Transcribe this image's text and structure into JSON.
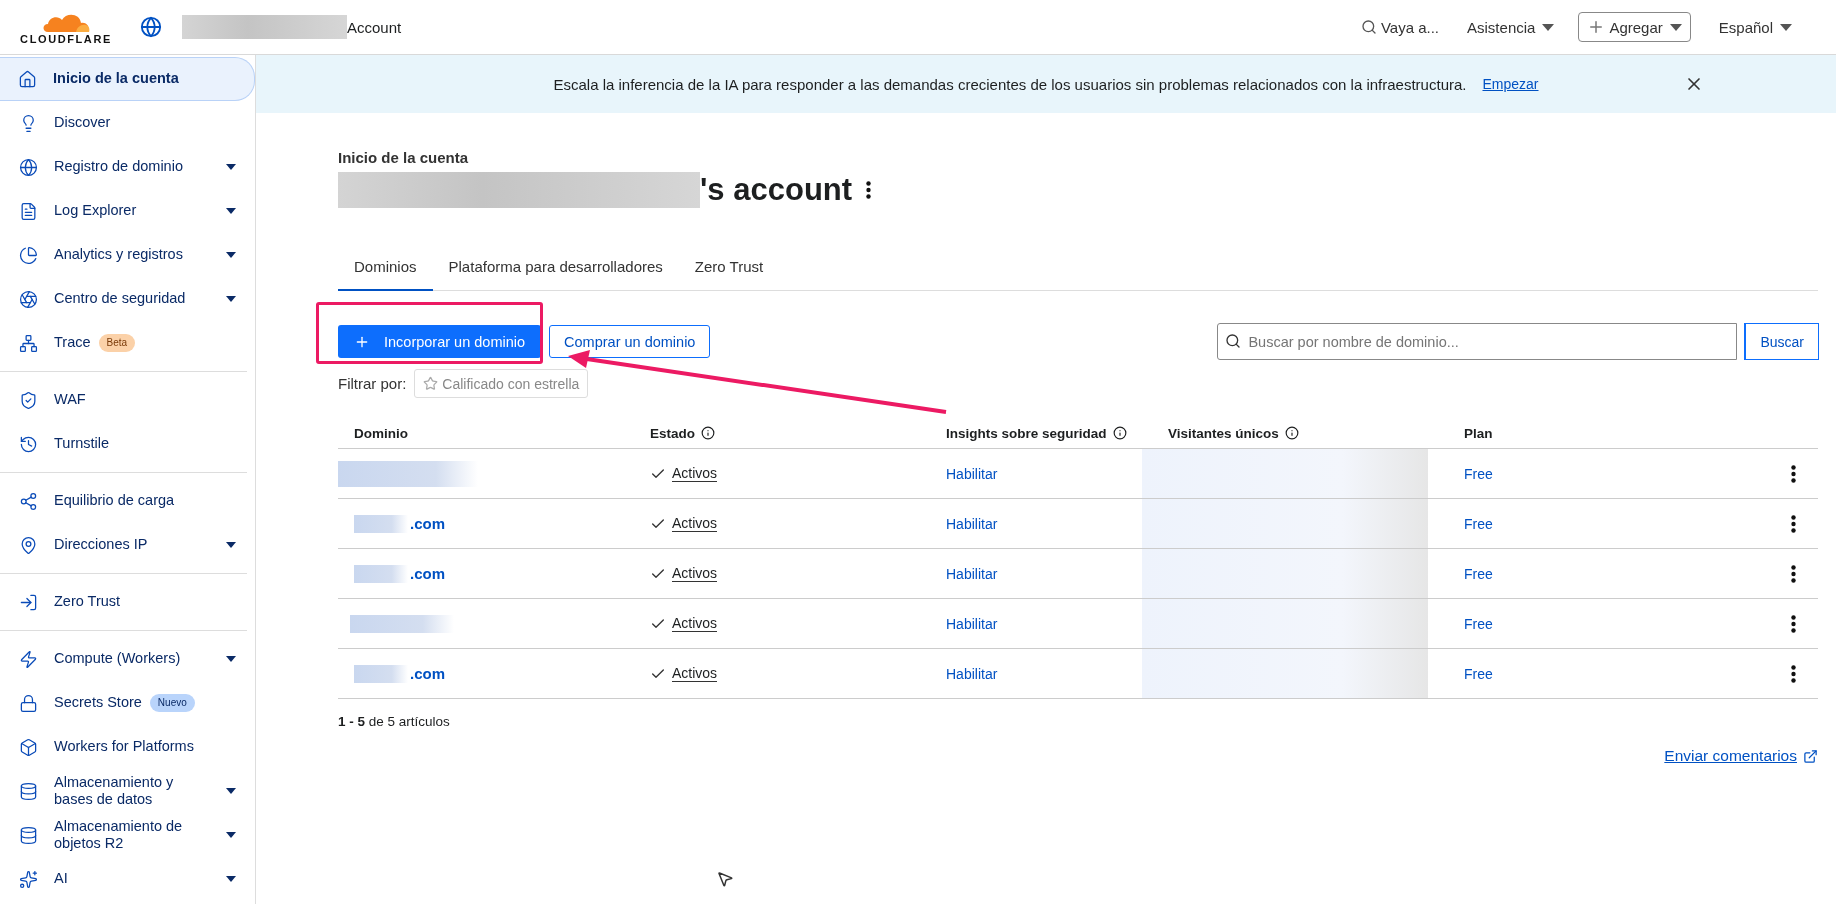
{
  "header": {
    "logo_text": "CLOUDFLARE",
    "account_label": "Account",
    "search_label": "Vaya a...",
    "menus": [
      {
        "label": "Asistencia",
        "kind": "plain"
      },
      {
        "label": "Agregar",
        "kind": "add"
      },
      {
        "label": "Español",
        "kind": "plain"
      }
    ]
  },
  "sidebar": {
    "groups": [
      {
        "items": [
          {
            "label": "Inicio de la cuenta",
            "selected": true,
            "expandable": false
          },
          {
            "label": "Discover",
            "selected": false,
            "expandable": false
          },
          {
            "label": "Registro de dominio",
            "selected": false,
            "expandable": true
          },
          {
            "label": "Log Explorer",
            "selected": false,
            "expandable": true
          },
          {
            "label": "Analytics y registros",
            "selected": false,
            "expandable": true
          },
          {
            "label": "Centro de seguridad",
            "selected": false,
            "expandable": true
          },
          {
            "label": "Trace",
            "selected": false,
            "expandable": false,
            "badge": {
              "text": "Beta",
              "kind": "beta"
            }
          }
        ]
      },
      {
        "items": [
          {
            "label": "WAF",
            "selected": false,
            "expandable": false
          },
          {
            "label": "Turnstile",
            "selected": false,
            "expandable": false
          }
        ]
      },
      {
        "items": [
          {
            "label": "Equilibrio de carga",
            "selected": false,
            "expandable": false
          },
          {
            "label": "Direcciones IP",
            "selected": false,
            "expandable": true
          }
        ]
      },
      {
        "items": [
          {
            "label": "Zero Trust",
            "selected": false,
            "expandable": false
          }
        ]
      },
      {
        "items": [
          {
            "label": "Compute (Workers)",
            "selected": false,
            "expandable": true
          },
          {
            "label": "Secrets Store",
            "selected": false,
            "expandable": false,
            "badge": {
              "text": "Nuevo",
              "kind": "new"
            }
          },
          {
            "label": "Workers for Platforms",
            "selected": false,
            "expandable": false
          },
          {
            "label": "Almacenamiento y bases de datos",
            "selected": false,
            "expandable": true
          },
          {
            "label": "Almacenamiento de objetos R2",
            "selected": false,
            "expandable": true
          },
          {
            "label": "AI",
            "selected": false,
            "expandable": true
          }
        ]
      }
    ]
  },
  "banner": {
    "text": "Escala la inferencia de la IA para responder a las demandas crecientes de los usuarios sin problemas relacionados con la infraestructura.",
    "link": "Empezar"
  },
  "page": {
    "breadcrumb": "Inicio de la cuenta",
    "title_suffix": "'s account"
  },
  "tabs": [
    {
      "label": "Dominios",
      "selected": true
    },
    {
      "label": "Plataforma para desarrolladores",
      "selected": false
    },
    {
      "label": "Zero Trust",
      "selected": false
    }
  ],
  "actions": {
    "primary": "Incorporar un dominio",
    "secondary": "Comprar un dominio"
  },
  "search": {
    "placeholder": "Buscar por nombre de dominio...",
    "button": "Buscar"
  },
  "filter": {
    "label": "Filtrar por:",
    "chip": "Calificado con estrella"
  },
  "table": {
    "columns": [
      {
        "label": "Dominio",
        "info": false
      },
      {
        "label": "Estado",
        "info": true
      },
      {
        "label": "Insights sobre seguridad",
        "info": true
      },
      {
        "label": "Visitantes únicos",
        "info": true
      },
      {
        "label": "Plan",
        "info": false
      }
    ],
    "rows": [
      {
        "domain_suffix": null,
        "status": "Activos",
        "insights": "Habilitar",
        "plan": "Free"
      },
      {
        "domain_suffix": ".com",
        "status": "Activos",
        "insights": "Habilitar",
        "plan": "Free"
      },
      {
        "domain_suffix": ".com",
        "status": "Activos",
        "insights": "Habilitar",
        "plan": "Free"
      },
      {
        "domain_suffix": null,
        "status": "Activos",
        "insights": "Habilitar",
        "plan": "Free"
      },
      {
        "domain_suffix": ".com",
        "status": "Activos",
        "insights": "Habilitar",
        "plan": "Free"
      }
    ]
  },
  "pagination": "**1 - 5** de 5 artículos",
  "feedback_link": "Enviar comentarios"
}
